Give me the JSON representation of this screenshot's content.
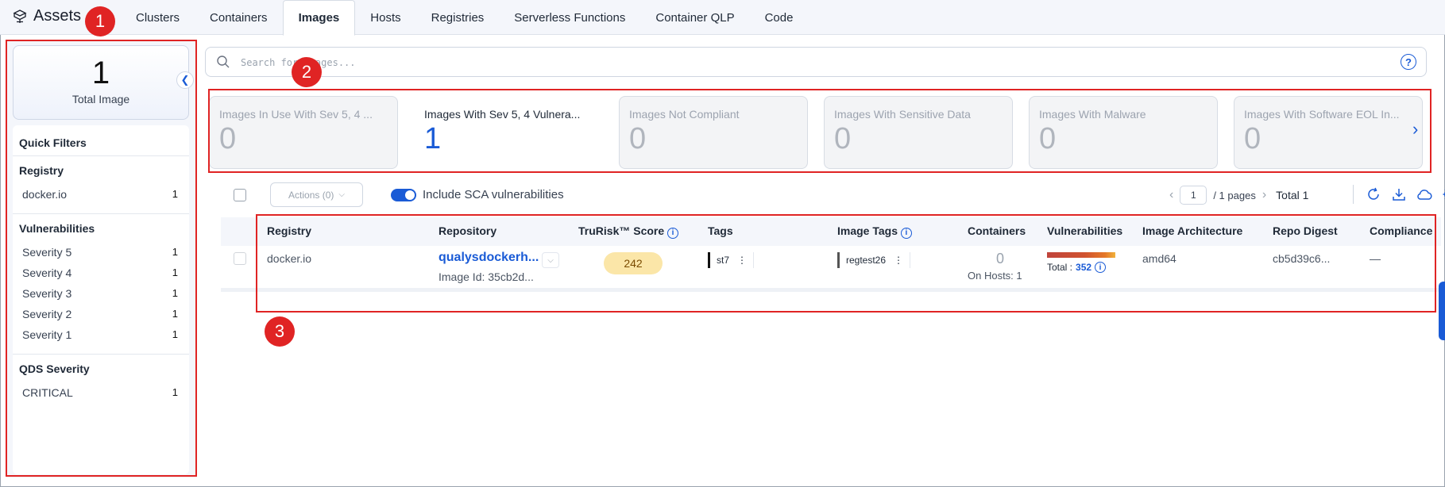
{
  "app": {
    "title": "Assets"
  },
  "tabs": [
    {
      "label": "Clusters"
    },
    {
      "label": "Containers"
    },
    {
      "label": "Images",
      "active": true
    },
    {
      "label": "Hosts"
    },
    {
      "label": "Registries"
    },
    {
      "label": "Serverless Functions"
    },
    {
      "label": "Container QLP"
    },
    {
      "label": "Code"
    }
  ],
  "sidebar": {
    "total": {
      "count": "1",
      "label": "Total Image"
    },
    "quick_filters_title": "Quick Filters",
    "registry": {
      "title": "Registry",
      "items": [
        {
          "label": "docker.io",
          "count": "1"
        }
      ]
    },
    "vulnerabilities": {
      "title": "Vulnerabilities",
      "items": [
        {
          "label": "Severity 5",
          "count": "1"
        },
        {
          "label": "Severity 4",
          "count": "1"
        },
        {
          "label": "Severity 3",
          "count": "1"
        },
        {
          "label": "Severity 2",
          "count": "1"
        },
        {
          "label": "Severity 1",
          "count": "1"
        }
      ]
    },
    "qds": {
      "title": "QDS Severity",
      "items": [
        {
          "label": "CRITICAL",
          "count": "1"
        }
      ]
    }
  },
  "search": {
    "placeholder": "Search for images...",
    "value": ""
  },
  "cards": [
    {
      "title": "Images In Use With Sev 5, 4 ...",
      "value": "0"
    },
    {
      "title": "Images With Sev 5, 4 Vulnera...",
      "value": "1",
      "active": true
    },
    {
      "title": "Images Not Compliant",
      "value": "0"
    },
    {
      "title": "Images With Sensitive Data",
      "value": "0"
    },
    {
      "title": "Images With Malware",
      "value": "0"
    },
    {
      "title": "Images With Software EOL In...",
      "value": "0"
    }
  ],
  "toolbar": {
    "actions_label": "Actions (0)",
    "sca_label": "Include SCA vulnerabilities",
    "sca_enabled": true,
    "page_value": "1",
    "pages_text": "/  1 pages",
    "total_text": "Total 1"
  },
  "table": {
    "headers": {
      "registry": "Registry",
      "repository": "Repository",
      "trurisk": "TruRisk™ Score",
      "tags": "Tags",
      "image_tags": "Image Tags",
      "containers": "Containers",
      "vulnerabilities": "Vulnerabilities",
      "architecture": "Image Architecture",
      "repo_digest": "Repo Digest",
      "compliance": "Compliance"
    },
    "rows": [
      {
        "registry": "docker.io",
        "repository": "qualysdockerh...",
        "image_id": "Image Id: 35cb2d...",
        "trurisk": "242",
        "tag": "st7",
        "image_tag": "regtest26",
        "containers": "0",
        "on_hosts": "On Hosts: 1",
        "vuln_total_label": "Total :",
        "vuln_total": "352",
        "architecture": "amd64",
        "repo_digest": "cb5d39c6...",
        "compliance": "—"
      }
    ]
  },
  "annotations": [
    {
      "label": "1"
    },
    {
      "label": "2"
    },
    {
      "label": "3"
    }
  ],
  "colors": {
    "accent": "#1a5bd6",
    "annotation": "#e02424",
    "score_bg": "#fbe6a8"
  }
}
